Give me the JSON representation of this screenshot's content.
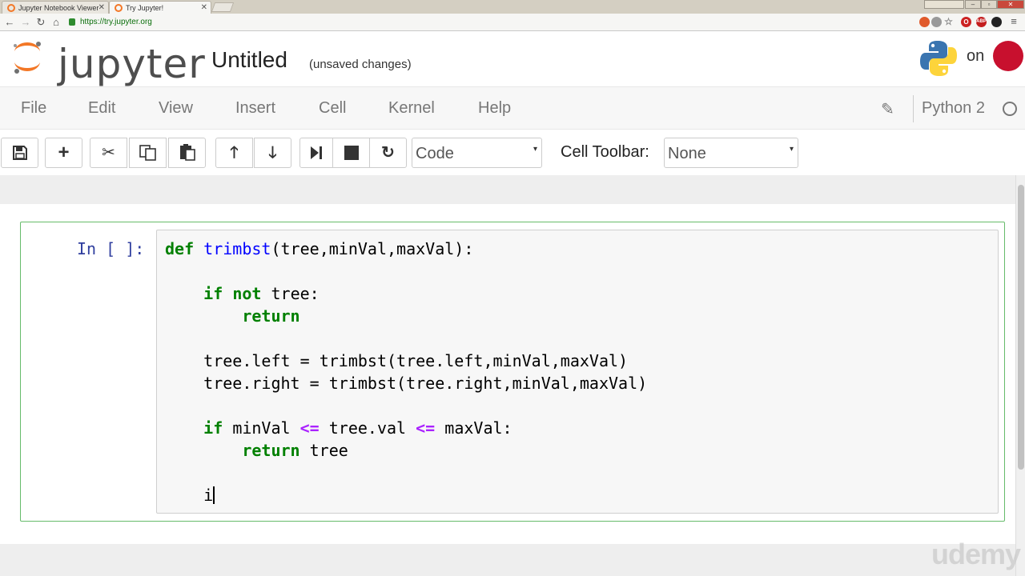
{
  "browser": {
    "tabs": [
      {
        "label": "Jupyter Notebook Viewer"
      },
      {
        "label": "Try Jupyter!"
      }
    ],
    "url": "https://try.jupyter.org"
  },
  "header": {
    "logo_text": "jupyter",
    "notebook_title": "Untitled",
    "save_status": "(unsaved changes)",
    "on_text": "on"
  },
  "menu": {
    "items": [
      "File",
      "Edit",
      "View",
      "Insert",
      "Cell",
      "Kernel",
      "Help"
    ],
    "kernel_name": "Python 2"
  },
  "toolbar": {
    "cell_type": "Code",
    "cell_toolbar_label": "Cell Toolbar:",
    "cell_toolbar_value": "None"
  },
  "cell": {
    "prompt": "In [ ]:",
    "code_lines": [
      "def trimbst(tree,minVal,maxVal):",
      "",
      "    if not tree:",
      "        return",
      "",
      "    tree.left = trimbst(tree.left,minVal,maxVal)",
      "    tree.right = trimbst(tree.right,minVal,maxVal)",
      "",
      "    if minVal <= tree.val <= maxVal:",
      "        return tree",
      "",
      "    i"
    ]
  },
  "watermark": "udemy",
  "colors": {
    "jupyter_orange": "#f37726",
    "cell_border_edit": "#66bb6a",
    "prompt_blue": "#303f9f",
    "keyword_green": "#008000",
    "function_blue": "#0000ff",
    "operator_purple": "#aa22ff"
  }
}
